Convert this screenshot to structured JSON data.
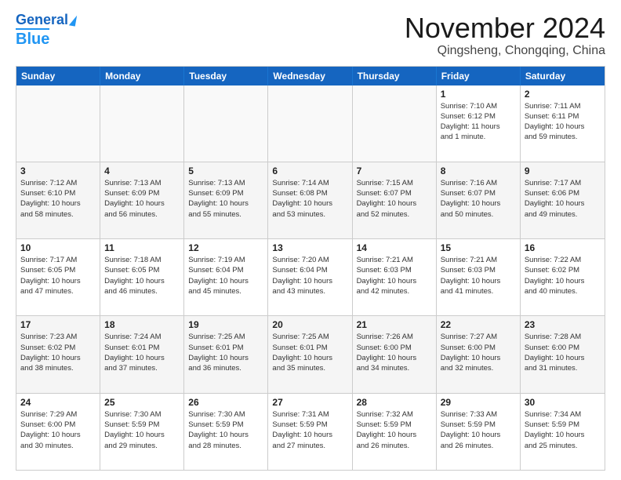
{
  "logo": {
    "line1": "General",
    "line2": "Blue"
  },
  "title": "November 2024",
  "location": "Qingsheng, Chongqing, China",
  "header_days": [
    "Sunday",
    "Monday",
    "Tuesday",
    "Wednesday",
    "Thursday",
    "Friday",
    "Saturday"
  ],
  "weeks": [
    [
      {
        "day": "",
        "text": ""
      },
      {
        "day": "",
        "text": ""
      },
      {
        "day": "",
        "text": ""
      },
      {
        "day": "",
        "text": ""
      },
      {
        "day": "",
        "text": ""
      },
      {
        "day": "1",
        "text": "Sunrise: 7:10 AM\nSunset: 6:12 PM\nDaylight: 11 hours\nand 1 minute."
      },
      {
        "day": "2",
        "text": "Sunrise: 7:11 AM\nSunset: 6:11 PM\nDaylight: 10 hours\nand 59 minutes."
      }
    ],
    [
      {
        "day": "3",
        "text": "Sunrise: 7:12 AM\nSunset: 6:10 PM\nDaylight: 10 hours\nand 58 minutes."
      },
      {
        "day": "4",
        "text": "Sunrise: 7:13 AM\nSunset: 6:09 PM\nDaylight: 10 hours\nand 56 minutes."
      },
      {
        "day": "5",
        "text": "Sunrise: 7:13 AM\nSunset: 6:09 PM\nDaylight: 10 hours\nand 55 minutes."
      },
      {
        "day": "6",
        "text": "Sunrise: 7:14 AM\nSunset: 6:08 PM\nDaylight: 10 hours\nand 53 minutes."
      },
      {
        "day": "7",
        "text": "Sunrise: 7:15 AM\nSunset: 6:07 PM\nDaylight: 10 hours\nand 52 minutes."
      },
      {
        "day": "8",
        "text": "Sunrise: 7:16 AM\nSunset: 6:07 PM\nDaylight: 10 hours\nand 50 minutes."
      },
      {
        "day": "9",
        "text": "Sunrise: 7:17 AM\nSunset: 6:06 PM\nDaylight: 10 hours\nand 49 minutes."
      }
    ],
    [
      {
        "day": "10",
        "text": "Sunrise: 7:17 AM\nSunset: 6:05 PM\nDaylight: 10 hours\nand 47 minutes."
      },
      {
        "day": "11",
        "text": "Sunrise: 7:18 AM\nSunset: 6:05 PM\nDaylight: 10 hours\nand 46 minutes."
      },
      {
        "day": "12",
        "text": "Sunrise: 7:19 AM\nSunset: 6:04 PM\nDaylight: 10 hours\nand 45 minutes."
      },
      {
        "day": "13",
        "text": "Sunrise: 7:20 AM\nSunset: 6:04 PM\nDaylight: 10 hours\nand 43 minutes."
      },
      {
        "day": "14",
        "text": "Sunrise: 7:21 AM\nSunset: 6:03 PM\nDaylight: 10 hours\nand 42 minutes."
      },
      {
        "day": "15",
        "text": "Sunrise: 7:21 AM\nSunset: 6:03 PM\nDaylight: 10 hours\nand 41 minutes."
      },
      {
        "day": "16",
        "text": "Sunrise: 7:22 AM\nSunset: 6:02 PM\nDaylight: 10 hours\nand 40 minutes."
      }
    ],
    [
      {
        "day": "17",
        "text": "Sunrise: 7:23 AM\nSunset: 6:02 PM\nDaylight: 10 hours\nand 38 minutes."
      },
      {
        "day": "18",
        "text": "Sunrise: 7:24 AM\nSunset: 6:01 PM\nDaylight: 10 hours\nand 37 minutes."
      },
      {
        "day": "19",
        "text": "Sunrise: 7:25 AM\nSunset: 6:01 PM\nDaylight: 10 hours\nand 36 minutes."
      },
      {
        "day": "20",
        "text": "Sunrise: 7:25 AM\nSunset: 6:01 PM\nDaylight: 10 hours\nand 35 minutes."
      },
      {
        "day": "21",
        "text": "Sunrise: 7:26 AM\nSunset: 6:00 PM\nDaylight: 10 hours\nand 34 minutes."
      },
      {
        "day": "22",
        "text": "Sunrise: 7:27 AM\nSunset: 6:00 PM\nDaylight: 10 hours\nand 32 minutes."
      },
      {
        "day": "23",
        "text": "Sunrise: 7:28 AM\nSunset: 6:00 PM\nDaylight: 10 hours\nand 31 minutes."
      }
    ],
    [
      {
        "day": "24",
        "text": "Sunrise: 7:29 AM\nSunset: 6:00 PM\nDaylight: 10 hours\nand 30 minutes."
      },
      {
        "day": "25",
        "text": "Sunrise: 7:30 AM\nSunset: 5:59 PM\nDaylight: 10 hours\nand 29 minutes."
      },
      {
        "day": "26",
        "text": "Sunrise: 7:30 AM\nSunset: 5:59 PM\nDaylight: 10 hours\nand 28 minutes."
      },
      {
        "day": "27",
        "text": "Sunrise: 7:31 AM\nSunset: 5:59 PM\nDaylight: 10 hours\nand 27 minutes."
      },
      {
        "day": "28",
        "text": "Sunrise: 7:32 AM\nSunset: 5:59 PM\nDaylight: 10 hours\nand 26 minutes."
      },
      {
        "day": "29",
        "text": "Sunrise: 7:33 AM\nSunset: 5:59 PM\nDaylight: 10 hours\nand 26 minutes."
      },
      {
        "day": "30",
        "text": "Sunrise: 7:34 AM\nSunset: 5:59 PM\nDaylight: 10 hours\nand 25 minutes."
      }
    ]
  ]
}
